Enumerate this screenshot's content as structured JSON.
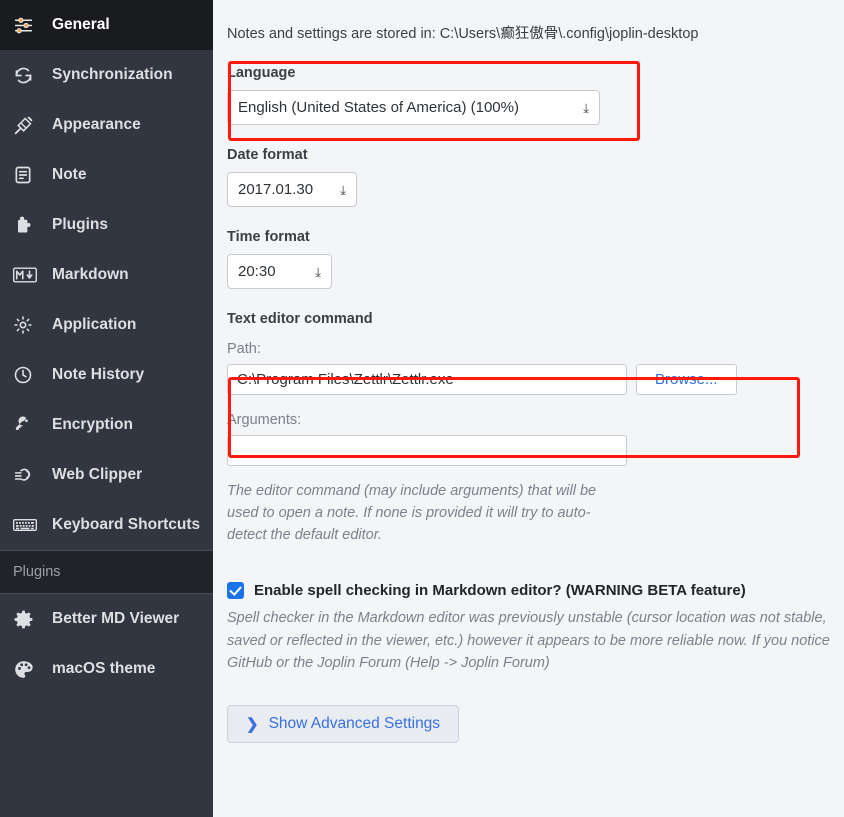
{
  "sidebar": {
    "items": [
      {
        "label": "General",
        "icon": "sliders-icon",
        "active": true
      },
      {
        "label": "Synchronization",
        "icon": "sync-icon",
        "active": false
      },
      {
        "label": "Appearance",
        "icon": "brush-icon",
        "active": false
      },
      {
        "label": "Note",
        "icon": "note-icon",
        "active": false
      },
      {
        "label": "Plugins",
        "icon": "puzzle-icon",
        "active": false
      },
      {
        "label": "Markdown",
        "icon": "markdown-icon",
        "active": false
      },
      {
        "label": "Application",
        "icon": "gear-icon",
        "active": false
      },
      {
        "label": "Note History",
        "icon": "clock-icon",
        "active": false
      },
      {
        "label": "Encryption",
        "icon": "key-icon",
        "active": false
      },
      {
        "label": "Web Clipper",
        "icon": "clipper-icon",
        "active": false
      },
      {
        "label": "Keyboard Shortcuts",
        "icon": "keyboard-icon",
        "active": false
      }
    ],
    "section_header": "Plugins",
    "plugin_items": [
      {
        "label": "Better MD Viewer",
        "icon": "gear-icon"
      },
      {
        "label": "macOS theme",
        "icon": "palette-icon"
      }
    ]
  },
  "content": {
    "storage_notice": "Notes and settings are stored in: C:\\Users\\癫狂傲骨\\.config\\joplin-desktop",
    "language": {
      "label": "Language",
      "value": "English (United States of America) (100%)",
      "options": [
        "English (United States of America) (100%)"
      ]
    },
    "date_format": {
      "label": "Date format",
      "value": "2017.01.30",
      "options": [
        "2017.01.30"
      ]
    },
    "time_format": {
      "label": "Time format",
      "value": "20:30",
      "options": [
        "20:30"
      ]
    },
    "text_editor_command": {
      "label": "Text editor command",
      "path_label": "Path:",
      "path_value": "C:\\Program Files\\Zettlr\\Zettlr.exe",
      "browse_label": "Browse...",
      "arguments_label": "Arguments:",
      "arguments_value": "",
      "help_line1": "The editor command (may include arguments) that will be",
      "help_line2": "used to open a note. If none is provided it will try to auto-",
      "help_line3": "detect the default editor."
    },
    "spell_check": {
      "label": "Enable spell checking in Markdown editor? (WARNING BETA feature)",
      "checked": true,
      "help_line1": "Spell checker in the Markdown editor was previously unstable (cursor location was not stable,",
      "help_line2": "saved or reflected in the viewer, etc.) however it appears to be more reliable now. If you notice",
      "help_line3": "GitHub or the Joplin Forum (Help -> Joplin Forum)"
    },
    "advanced_button": {
      "label": "Show Advanced Settings",
      "icon": "chevron-right-icon"
    }
  },
  "annotations": {
    "box1_name": "language-highlight-box",
    "box2_name": "path-highlight-box",
    "color": "#ff1a0d"
  },
  "colors": {
    "sidebar_bg": "#313640",
    "sidebar_active_bg": "#1a1b1f",
    "content_bg": "#f4f5f6",
    "accent_blue": "#3a6fe0",
    "checkbox_blue": "#1a73e8",
    "annotation_red": "#ff1a0d"
  }
}
